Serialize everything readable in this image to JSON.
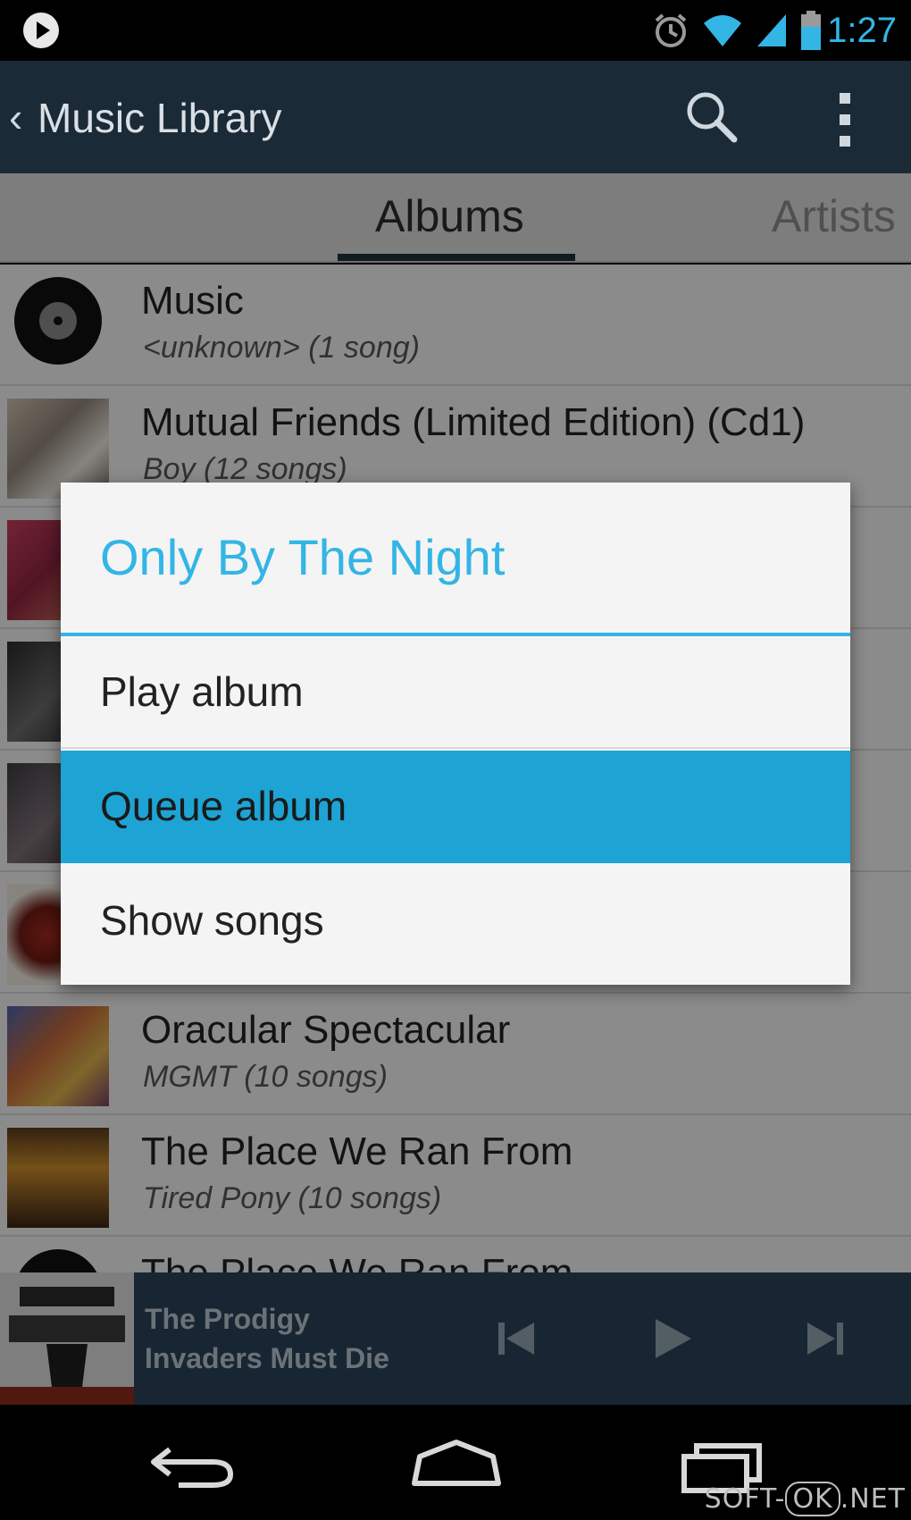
{
  "status_bar": {
    "time": "1:27",
    "icons": [
      "play-notification-icon",
      "alarm-icon",
      "wifi-icon",
      "signal-icon",
      "battery-icon"
    ]
  },
  "action_bar": {
    "title": "Music Library",
    "icons": [
      "back-caret-icon",
      "search-icon",
      "overflow-menu-icon"
    ]
  },
  "tabs": [
    {
      "label": "Albums",
      "selected": true
    },
    {
      "label": "Artists",
      "selected": false
    }
  ],
  "albums": [
    {
      "title": "Music",
      "subtitle": "<unknown> (1 song)"
    },
    {
      "title": "Mutual Friends (Limited Edition) (Cd1)",
      "subtitle": "Boy (12 songs)"
    },
    {
      "title": "",
      "subtitle": ""
    },
    {
      "title": "",
      "subtitle": ""
    },
    {
      "title": "",
      "subtitle": ""
    },
    {
      "title": "",
      "subtitle": ""
    },
    {
      "title": "Oracular Spectacular",
      "subtitle": "MGMT (10 songs)"
    },
    {
      "title": "The Place We Ran From",
      "subtitle": "Tired Pony (10 songs)"
    },
    {
      "title": "The Place We Ran From",
      "subtitle": ""
    }
  ],
  "dialog": {
    "title": "Only By The Night",
    "items": [
      "Play album",
      "Queue album",
      "Show songs"
    ],
    "selected_index": 1
  },
  "now_playing": {
    "artist": "The Prodigy",
    "track": "Invaders Must Die",
    "controls": [
      "previous-icon",
      "play-icon",
      "next-icon"
    ]
  },
  "nav_bar": {
    "buttons": [
      "back-icon",
      "home-icon",
      "recents-icon"
    ]
  },
  "watermark": {
    "prefix": "SOFT-",
    "boxed": "OK",
    "suffix": ".NET"
  },
  "colors": {
    "accent": "#33b5e5",
    "selected_item": "#1da4d5",
    "action_bar": "#1b2a37",
    "now_playing_bar": "#2a4358"
  }
}
